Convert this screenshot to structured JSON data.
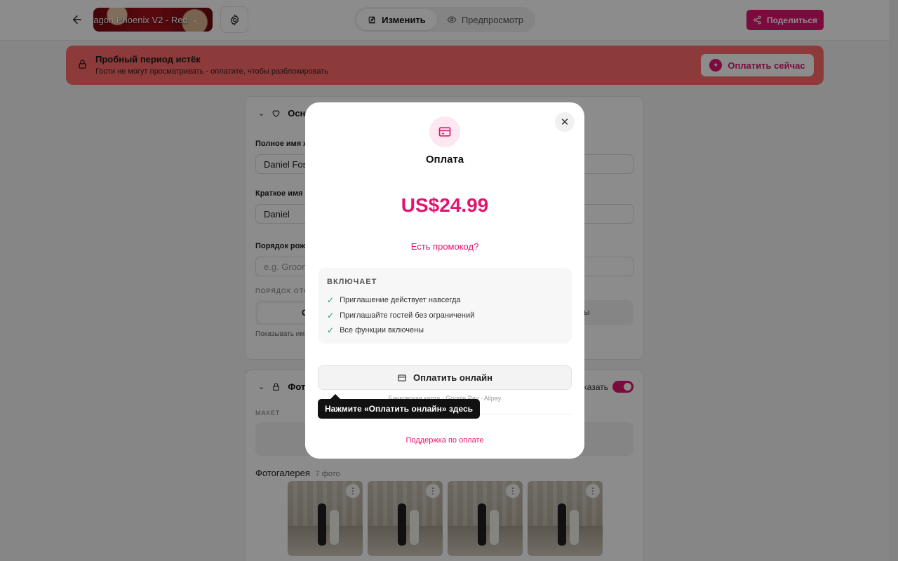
{
  "header": {
    "theme_name": "ragon Phoenix V2 - Red",
    "tabs": [
      {
        "label": "Изменить",
        "active": true
      },
      {
        "label": "Предпросмотр",
        "active": false
      }
    ],
    "share_label": "Поделиться"
  },
  "banner": {
    "title": "Пробный период истёк",
    "subtitle": "Гости не могут просматривать - оплатите, чтобы разблокировать",
    "pay_label": "Оплатить сейчас"
  },
  "editor": {
    "section1_title": "Осн",
    "full_name_label": "Полное имя ж",
    "full_name_value": "Daniel Fos",
    "short_name_label": "Краткое имя",
    "short_name_value": "Daniel",
    "birth_order_label": "Порядок рож",
    "birth_order_placeholder": "e.g. Groom",
    "order_caps": "ПОРЯДОК ОТО",
    "option_left": "С",
    "option_right": "ы",
    "hint": "Показывать им",
    "section2_title": "Фот",
    "toggle_label": "казать",
    "layout_caps": "МАКЕТ",
    "gallery_title": "Фотогалерея",
    "gallery_count": "7 фото"
  },
  "modal": {
    "title": "Оплата",
    "price": "US$24.99",
    "promo_link": "Есть промокод?",
    "includes_caption": "ВКЛЮЧАЕТ",
    "features": [
      "Приглашение действует навсегда",
      "Приглашайте гостей без ограничений",
      "Все функции включены"
    ],
    "pay_online_label": "Оплатить онлайн",
    "payment_methods": "Банковская карта · Google Pay · Alipay",
    "support_link": "Поддержка по оплате"
  },
  "tooltip": {
    "text": "Нажмите «Оплатить онлайн» здесь"
  },
  "colors": {
    "accent": "#e2146f",
    "banner": "#ff6b6b",
    "check": "#22a06b"
  }
}
